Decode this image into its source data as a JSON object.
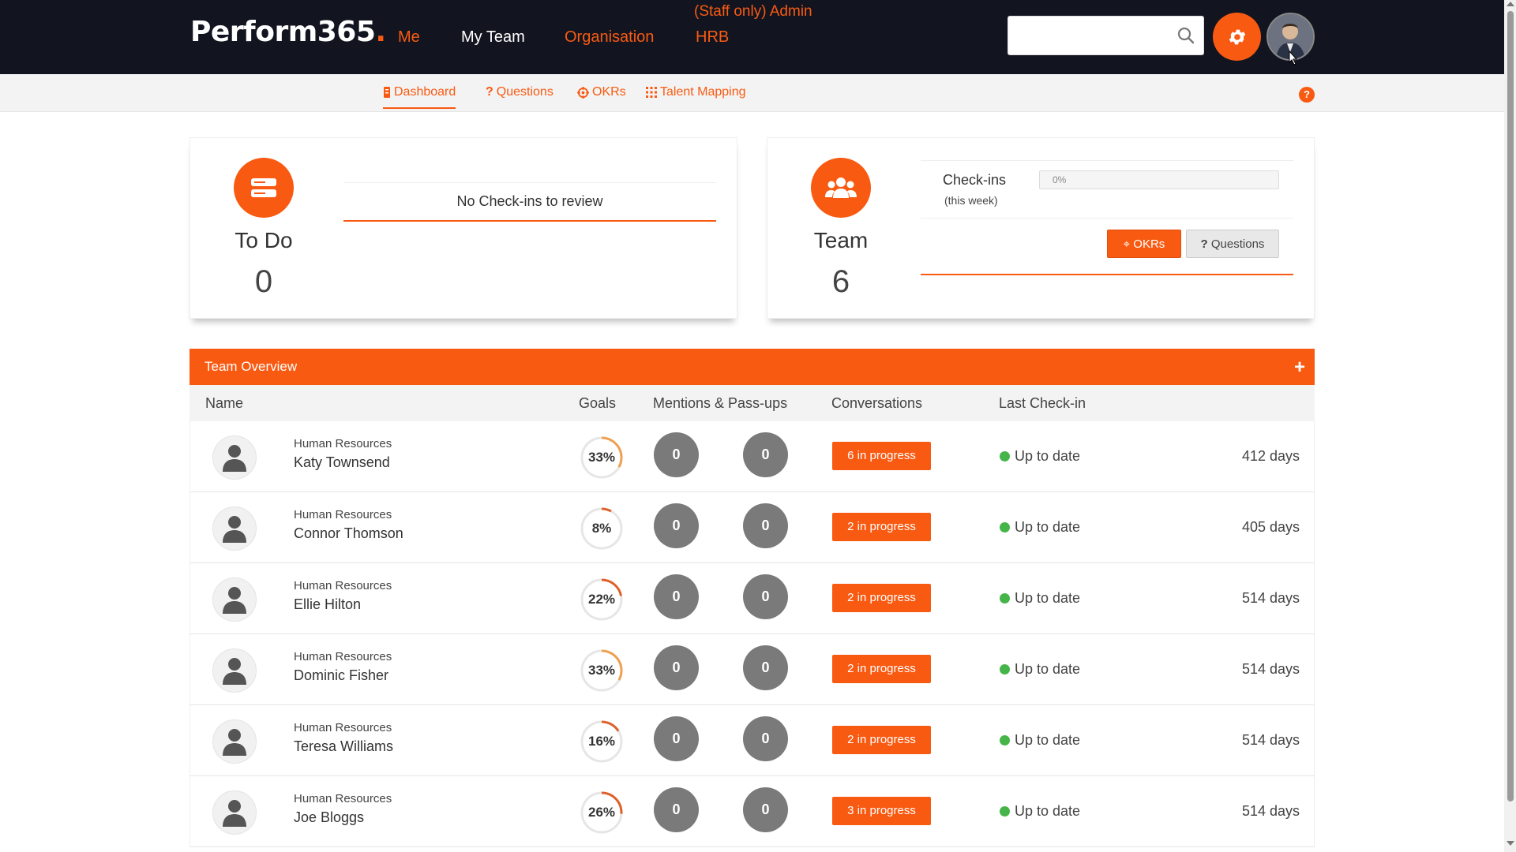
{
  "app": {
    "logo_text": "Perform365",
    "logo_dot": ".",
    "brand_color": "#f95a12"
  },
  "topnav": {
    "items": [
      {
        "label": "Me"
      },
      {
        "label": "My Team"
      },
      {
        "label": "Organisation"
      },
      {
        "label": "HRB"
      }
    ],
    "admin_label": "(Staff only) Admin",
    "search_placeholder": "",
    "settings_icon": "gear-icon",
    "avatar_icon": "user-avatar"
  },
  "subnav": {
    "items": [
      {
        "label": "Dashboard",
        "icon": "dashboard-icon"
      },
      {
        "label": "Questions",
        "icon": "question-icon"
      },
      {
        "label": "OKRs",
        "icon": "target-icon"
      },
      {
        "label": "Talent Mapping",
        "icon": "grid-icon"
      }
    ],
    "help_label": "?"
  },
  "todo_card": {
    "title": "To Do",
    "count": "0",
    "message": "No Check-ins to review"
  },
  "team_card": {
    "title": "Team",
    "count": "6",
    "checkins_label": "Check-ins",
    "checkins_sub": "(this week)",
    "checkins_progress": "0%",
    "okrs_button": "OKRs",
    "questions_button": "Questions"
  },
  "overview": {
    "title": "Team Overview",
    "add_label": "+",
    "columns": {
      "name": "Name",
      "goals": "Goals",
      "mentions": "Mentions & Pass-ups",
      "conversations": "Conversations",
      "last_checkin": "Last Check-in"
    },
    "rows": [
      {
        "dept": "Human Resources",
        "name": "Katy Townsend",
        "goal_pct": 33,
        "goal_label": "33%",
        "mentions": "0",
        "passups": "0",
        "conversations": "6 in progress",
        "status": "Up to date",
        "days": "412 days"
      },
      {
        "dept": "Human Resources",
        "name": "Connor Thomson",
        "goal_pct": 8,
        "goal_label": "8%",
        "mentions": "0",
        "passups": "0",
        "conversations": "2 in progress",
        "status": "Up to date",
        "days": "405 days"
      },
      {
        "dept": "Human Resources",
        "name": "Ellie Hilton",
        "goal_pct": 22,
        "goal_label": "22%",
        "mentions": "0",
        "passups": "0",
        "conversations": "2 in progress",
        "status": "Up to date",
        "days": "514 days"
      },
      {
        "dept": "Human Resources",
        "name": "Dominic Fisher",
        "goal_pct": 33,
        "goal_label": "33%",
        "mentions": "0",
        "passups": "0",
        "conversations": "2 in progress",
        "status": "Up to date",
        "days": "514 days"
      },
      {
        "dept": "Human Resources",
        "name": "Teresa Williams",
        "goal_pct": 16,
        "goal_label": "16%",
        "mentions": "0",
        "passups": "0",
        "conversations": "2 in progress",
        "status": "Up to date",
        "days": "514 days"
      },
      {
        "dept": "Human Resources",
        "name": "Joe Bloggs",
        "goal_pct": 26,
        "goal_label": "26%",
        "mentions": "0",
        "passups": "0",
        "conversations": "3 in progress",
        "status": "Up to date",
        "days": "514 days"
      }
    ]
  }
}
